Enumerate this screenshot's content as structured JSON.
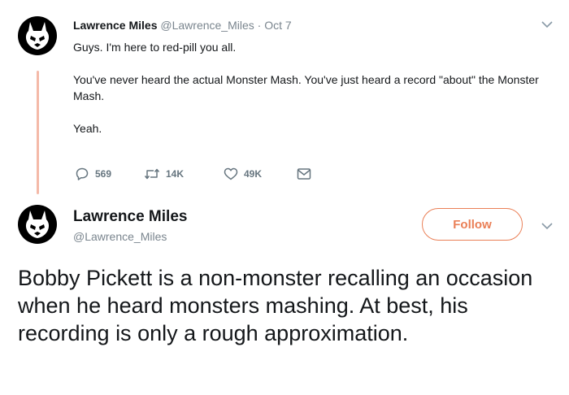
{
  "tweet1": {
    "author_name": "Lawrence Miles",
    "author_handle": "@Lawrence_Miles",
    "separator": "·",
    "date": "Oct 7",
    "paragraphs": [
      "Guys. I'm here to red-pill you all.",
      "You've never heard the actual Monster Mash. You've just heard a record \"about\" the Monster Mash.",
      "Yeah."
    ],
    "actions": {
      "reply_count": "569",
      "retweet_count": "14K",
      "like_count": "49K"
    }
  },
  "tweet2": {
    "author_name": "Lawrence Miles",
    "author_handle": "@Lawrence_Miles",
    "follow_label": "Follow",
    "text": "Bobby Pickett is a non-monster recalling an occasion when he heard monsters mashing. At best, his recording is only a rough approximation."
  },
  "colors": {
    "accent": "#ea7f56",
    "thread_line": "#f4b9a8",
    "muted_text": "#7a858e"
  },
  "icons": [
    "avatar-logo-icon",
    "chevron-down-icon",
    "reply-icon",
    "retweet-icon",
    "like-icon",
    "dm-icon"
  ]
}
